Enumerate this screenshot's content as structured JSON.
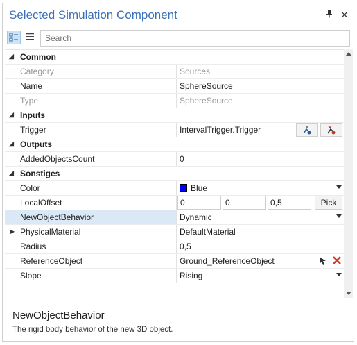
{
  "window": {
    "title": "Selected Simulation Component",
    "pin_glyph": "⊥",
    "close_glyph": "✕"
  },
  "toolbar": {
    "search_placeholder": "Search"
  },
  "grid": {
    "common": {
      "label": "Common",
      "category_name": "Category",
      "category_value": "Sources",
      "name_name": "Name",
      "name_value": "SphereSource",
      "type_name": "Type",
      "type_value": "SphereSource"
    },
    "inputs": {
      "label": "Inputs",
      "trigger_name": "Trigger",
      "trigger_value": "IntervalTrigger.Trigger"
    },
    "outputs": {
      "label": "Outputs",
      "added_name": "AddedObjectsCount",
      "added_value": "0"
    },
    "sonstiges": {
      "label": "Sonstiges",
      "color_name": "Color",
      "color_value": "Blue",
      "color_hex": "#0000ff",
      "offset_name": "LocalOffset",
      "offset_x": "0",
      "offset_y": "0",
      "offset_z": "0,5",
      "pick_label": "Pick",
      "behavior_name": "NewObjectBehavior",
      "behavior_value": "Dynamic",
      "material_name": "PhysicalMaterial",
      "material_value": "DefaultMaterial",
      "radius_name": "Radius",
      "radius_value": "0,5",
      "reference_name": "ReferenceObject",
      "reference_value": "Ground_ReferenceObject",
      "slope_name": "Slope",
      "slope_value": "Rising"
    }
  },
  "description": {
    "title": "NewObjectBehavior",
    "text": "The rigid body behavior of the new 3D object."
  }
}
